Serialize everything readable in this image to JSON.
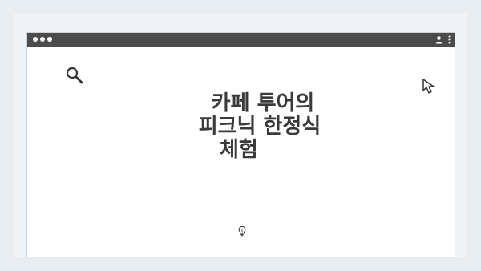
{
  "window": {
    "controls": [
      "close-dot",
      "minimize-dot",
      "maximize-dot"
    ],
    "top_indicator_dots": "○ ○ ○ ○"
  },
  "content": {
    "title_lines": [
      "카페 투어의",
      "피크닉 한정식",
      "체험"
    ]
  },
  "icons": {
    "search": "search-icon",
    "cursor": "cursor-icon",
    "bulb": "lightbulb-icon",
    "user": "user-icon",
    "menu": "vertical-menu-icon"
  },
  "colors": {
    "background": "#e8edf2",
    "titlebar": "#4b4b4b",
    "text": "#3a3a3a",
    "icon_stroke": "#333333"
  }
}
